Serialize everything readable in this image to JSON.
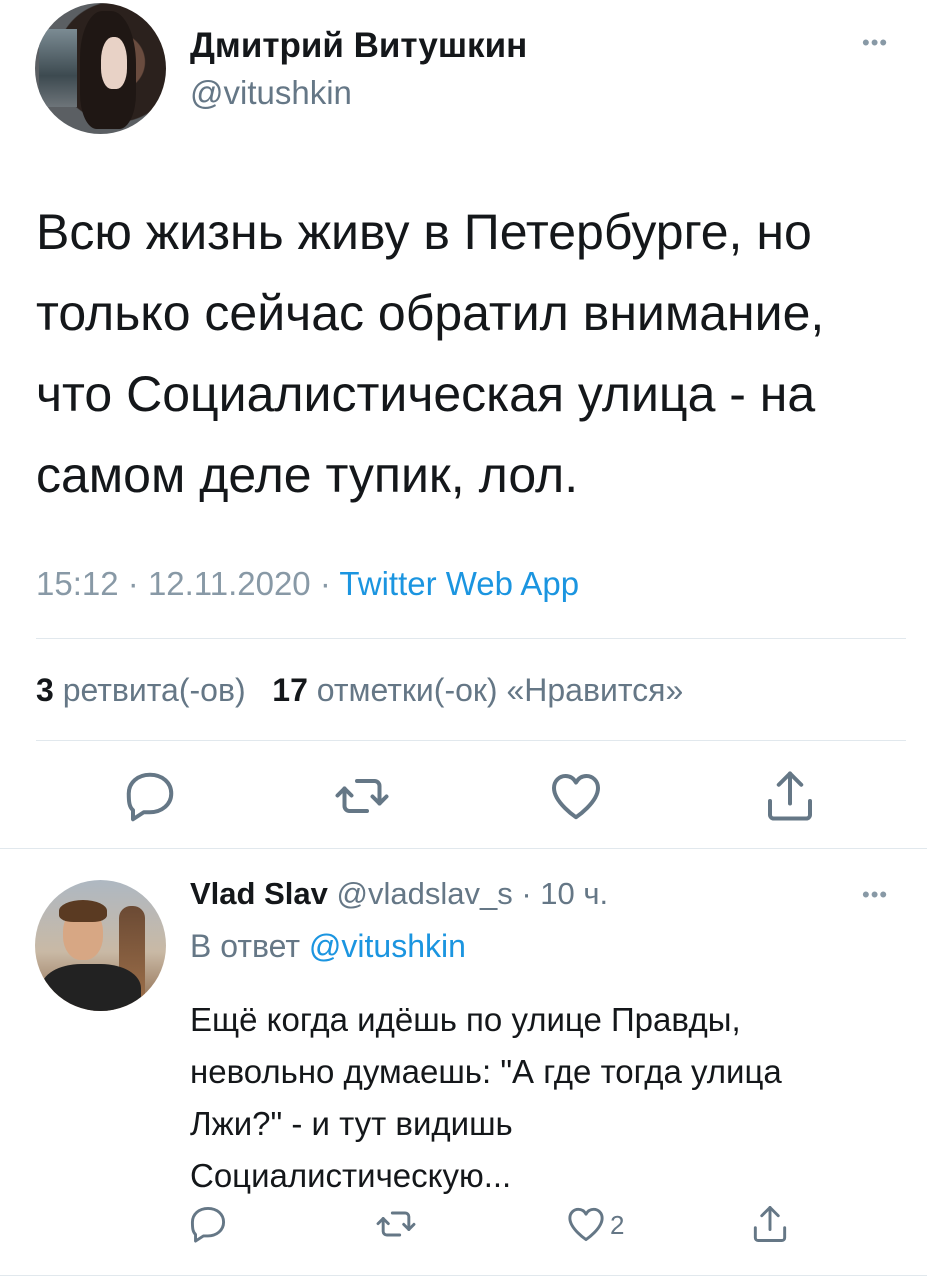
{
  "tweet": {
    "author_name": "Дмитрий Витушкин",
    "author_handle": "@vitushkin",
    "more_icon": "more-horizontal-icon",
    "more_label": "•••",
    "text_lines": [
      "Всю жизнь живу в Петербурге, но",
      "только сейчас обратил внимание,",
      "что Социалистическая улица - на",
      "самом деле тупик, лол."
    ],
    "time": "15:12",
    "date": "12.11.2020",
    "separator": "·",
    "source_app": "Twitter Web App",
    "retweets_count": "3",
    "retweets_label": "ретвита(-ов)",
    "likes_count": "17",
    "likes_label": "отметки(-ок) «Нравится»",
    "actions": [
      "reply-icon",
      "retweet-icon",
      "like-icon",
      "share-icon"
    ]
  },
  "reply": {
    "author_name": "Vlad Slav",
    "author_handle": "@vladslav_s",
    "separator": "·",
    "time_ago": "10 ч.",
    "reply_to_prefix": "В ответ",
    "reply_to_handle": "@vitushkin",
    "more_label": "•••",
    "text_lines": [
      "Ещё когда идёшь по улице Правды,",
      "невольно думаешь: \"А где тогда улица",
      "Лжи?\" - и тут видишь",
      "Социалистическую..."
    ],
    "like_count": "2"
  },
  "colors": {
    "text": "#14171a",
    "secondary": "#657786",
    "accent": "#1b95e0",
    "divider": "#e1e8ed"
  }
}
